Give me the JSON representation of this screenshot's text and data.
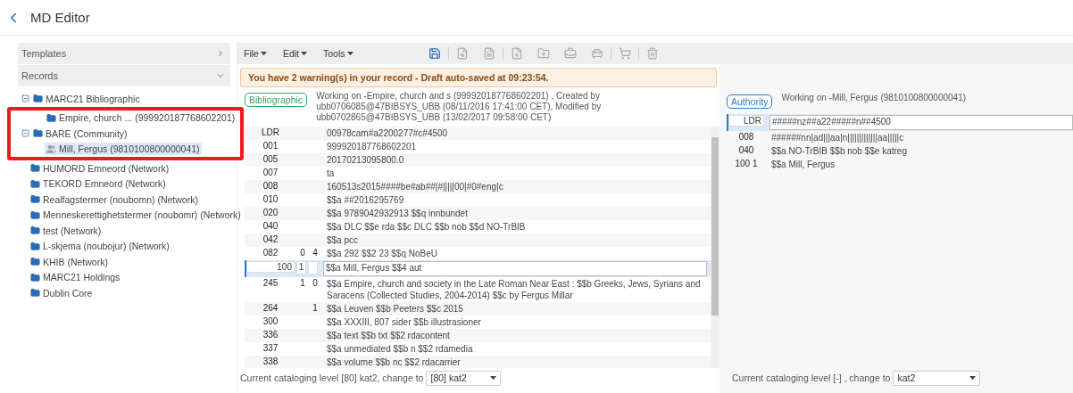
{
  "app": {
    "title": "MD Editor"
  },
  "sidebar": {
    "sections": [
      {
        "label": "Templates",
        "expanded": false
      },
      {
        "label": "Records",
        "expanded": true
      }
    ],
    "tree": [
      {
        "label": "MARC21 Bibliographic",
        "kind": "folder",
        "expanded": true,
        "selected": false,
        "children": [
          {
            "label": "Empire, church ... (999920187768602201)",
            "kind": "record",
            "selected": false
          }
        ]
      },
      {
        "label": "BARE (Community)",
        "kind": "folder",
        "expanded": true,
        "selected": false,
        "children": [
          {
            "label": "Mill, Fergus (9810100800000041)",
            "kind": "person",
            "selected": true
          }
        ]
      },
      {
        "label": "HUMORD Emneord (Network)",
        "kind": "folder",
        "expanded": false,
        "selected": false
      },
      {
        "label": "TEKORD Emneord (Network)",
        "kind": "folder",
        "expanded": false,
        "selected": false
      },
      {
        "label": "Realfagstermer (noubomn) (Network)",
        "kind": "folder",
        "expanded": false,
        "selected": false
      },
      {
        "label": "Menneskerettighetstermer (noubomr) (Network)",
        "kind": "folder",
        "expanded": false,
        "selected": false
      },
      {
        "label": "test (Network)",
        "kind": "folder",
        "expanded": false,
        "selected": false
      },
      {
        "label": "L-skjema (noubojur) (Network)",
        "kind": "folder",
        "expanded": false,
        "selected": false
      },
      {
        "label": "KHIB (Network)",
        "kind": "folder",
        "expanded": false,
        "selected": false
      },
      {
        "label": "MARC21 Holdings",
        "kind": "folder",
        "expanded": false,
        "selected": false
      },
      {
        "label": "Dublin Core",
        "kind": "folder",
        "expanded": false,
        "selected": false
      }
    ]
  },
  "menus": [
    {
      "label": "File"
    },
    {
      "label": "Edit"
    },
    {
      "label": "Tools"
    }
  ],
  "toolbar": [
    {
      "kind": "save",
      "disabled": false
    },
    {
      "kind": "separator"
    },
    {
      "kind": "search-doc",
      "disabled": true
    },
    {
      "kind": "search-list",
      "disabled": true
    },
    {
      "kind": "separator"
    },
    {
      "kind": "doc-plus",
      "disabled": true
    },
    {
      "kind": "folder-plus",
      "disabled": true
    },
    {
      "kind": "briefcase-plus",
      "disabled": true
    },
    {
      "kind": "car-plus",
      "disabled": true
    },
    {
      "kind": "separator"
    },
    {
      "kind": "cart",
      "disabled": true
    },
    {
      "kind": "separator"
    },
    {
      "kind": "trash",
      "disabled": true
    }
  ],
  "warning": "You have 2 warning(s) in your record - Draft auto-saved at 09:23:54.",
  "records": [
    {
      "badge": {
        "label": "Bibliographic",
        "kind": "bibliographic"
      },
      "info": "Working on -Empire, church and s (999920187768602201) , Created by ubb0706085@47BIBSYS_UBB (08/11/2016 17:41:00 CET), Modified by ubb0702865@47BIBSYS_UBB (13/02/2017 09:58:00 CET)",
      "fields": [
        {
          "tag": "LDR",
          "value": "00978cam#a2200277#c#4500",
          "selected": false
        },
        {
          "tag": "001",
          "value": "999920187768602201",
          "selected": false
        },
        {
          "tag": "005",
          "value": "20170213095800.0",
          "selected": false
        },
        {
          "tag": "007",
          "value": "ta",
          "selected": false
        },
        {
          "tag": "008",
          "value": "160513s2015####be#ab##|#|||||00|#0#eng|c",
          "selected": false
        },
        {
          "tag": "010",
          "value": "$$a ##2016295769",
          "selected": false
        },
        {
          "tag": "020",
          "value": "$$a 9789042932913 $$q innbundet",
          "selected": false
        },
        {
          "tag": "040",
          "value": "$$a DLC $$e rda $$c DLC $$b nob $$d NO-TrBIB",
          "selected": false
        },
        {
          "tag": "042",
          "value": "$$a pcc",
          "selected": false
        },
        {
          "tag": "082",
          "ind1": "0",
          "ind2": "4",
          "value": "$$a 292 $$2 23 $$q NoBeU",
          "selected": false
        },
        {
          "tag": "100",
          "ind1": "1",
          "value": "$$a Mill, Fergus $$4 aut",
          "selected": true
        },
        {
          "tag": "245",
          "ind1": "1",
          "ind2": "0",
          "value": "$$a Empire, church and society in the Late Roman Near East : $$b Greeks, Jews, Syrians and Saracens (Collected Studies, 2004-2014) $$c by Fergus Millar",
          "selected": false
        },
        {
          "tag": "264",
          "ind2": "1",
          "value": "$$a Leuven $$b Peeters $$c 2015",
          "selected": false
        },
        {
          "tag": "300",
          "value": "$$a XXXIII, 807 sider $$b illustrasioner",
          "selected": false
        },
        {
          "tag": "336",
          "value": "$$a text $$b txt $$2 rdacontent",
          "selected": false
        },
        {
          "tag": "337",
          "value": "$$a unmediated $$b n $$2 rdamedia",
          "selected": false
        },
        {
          "tag": "338",
          "value": "$$a volume $$b nc $$2 rdacarrier",
          "selected": false
        }
      ],
      "level_label": "Current cataloging level [80] kat2, change to",
      "level_select": "[80] kat2"
    },
    {
      "badge": {
        "label": "Authority",
        "kind": "authority"
      },
      "info": "Working on -Mill, Fergus (9810100800000041)",
      "fields": [
        {
          "tag": "LDR",
          "value": "#####nz##a22#####n##4500",
          "selected": true
        },
        {
          "tag": "008",
          "value": "######nn|ad|||aa|n|||||||||||||aa|||||c",
          "selected": false
        },
        {
          "tag": "040",
          "value": "$$a NO-TrBIB $$b nob $$e katreg",
          "selected": false
        },
        {
          "tag": "100 1",
          "value": "$$a Mill, Fergus",
          "selected": false
        }
      ],
      "level_label": "Current cataloging level [-] , change to",
      "level_select": "kat2"
    }
  ]
}
